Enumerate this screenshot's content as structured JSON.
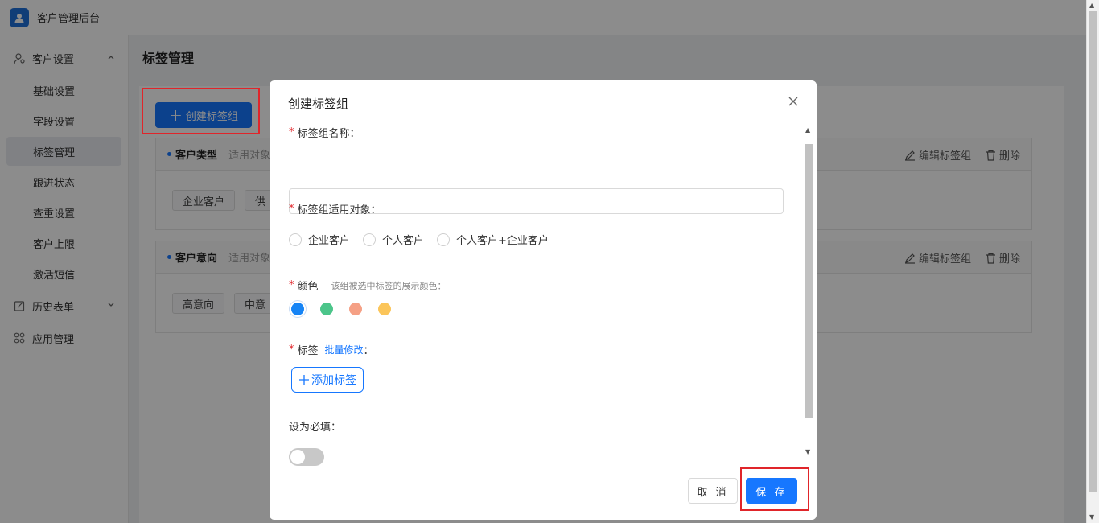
{
  "app": {
    "title": "客户管理后台"
  },
  "sidebar": {
    "groups": [
      {
        "label": "客户设置",
        "icon": "user-settings-icon",
        "expanded": true
      },
      {
        "label": "历史表单",
        "icon": "form-edit-icon",
        "expanded": false
      },
      {
        "label": "应用管理",
        "icon": "apps-grid-icon",
        "expanded": false
      }
    ],
    "items": [
      "基础设置",
      "字段设置",
      "标签管理",
      "跟进状态",
      "查重设置",
      "客户上限",
      "激活短信"
    ],
    "active_item": "标签管理"
  },
  "page": {
    "title": "标签管理",
    "create_button": "创建标签组",
    "groups": [
      {
        "name": "客户类型",
        "scope": "适用对象",
        "tags": [
          "企业客户",
          "供"
        ]
      },
      {
        "name": "客户意向",
        "scope": "适用对象",
        "tags": [
          "高意向",
          "中意"
        ]
      }
    ],
    "edit_label": "编辑标签组",
    "delete_label": "删除"
  },
  "modal": {
    "title": "创建标签组",
    "name_label": "标签组名称：",
    "name_value": "",
    "scope_label": "标签组适用对象：",
    "scope_options": [
      "企业客户",
      "个人客户",
      "个人客户+企业客户"
    ],
    "color_label": "颜色",
    "color_hint": "该组被选中标签的展示颜色：",
    "colors": [
      "#1684f5",
      "#4cc58a",
      "#f5a085",
      "#fbc55a"
    ],
    "selected_color": "#1684f5",
    "tag_label": "标签",
    "batch_edit": "批量修改",
    "tag_label_suffix": "：",
    "add_tag_button": "添加标签",
    "required_label": "设为必填：",
    "required_on": false,
    "cancel_button": "取 消",
    "save_button": "保 存"
  }
}
